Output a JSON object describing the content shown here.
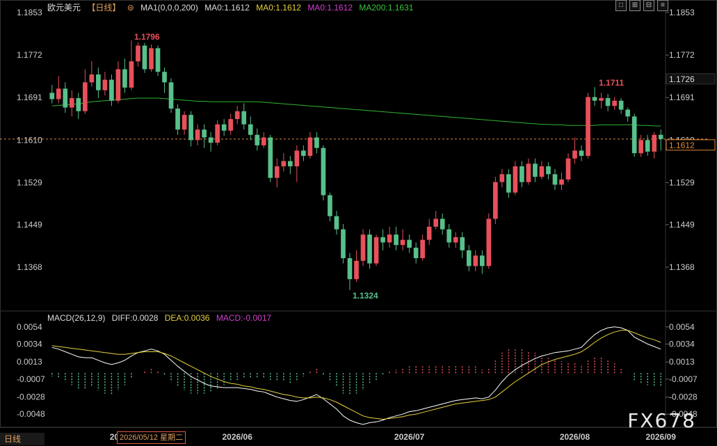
{
  "header": {
    "symbol": "欧元美元",
    "period": "【日线】",
    "ma_label": "MA1(0,0,0,200)",
    "ma0_white": "MA0:1.1612",
    "ma0_yellow": "MA0:1.1612",
    "ma0_magenta": "MA0:1.1612",
    "ma200": "MA200:1.1631"
  },
  "macd_header": {
    "label": "MACD(26,12,9)",
    "diff": "DIFF:0.0028",
    "dea": "DEA:0.0036",
    "macd": "MACD:-0.0017"
  },
  "bottom": {
    "tab_label": "日线",
    "selected_date": "2026/05/12 星期二",
    "watermark": "FX678"
  },
  "toolbar": [
    "□",
    "⊞",
    "⊟",
    "≡"
  ],
  "colors": {
    "up": "#e8505b",
    "down": "#58c08a",
    "ma200": "#2fb52f",
    "diff": "#ffffff",
    "dea": "#e6d23c",
    "price_line": "#e08a3a"
  },
  "chart_data": [
    {
      "type": "candlestick",
      "title": "欧元美元",
      "ylim": [
        1.1287,
        1.1853
      ],
      "y_ticks": [
        "1.1853",
        "1.1772",
        "1.1691",
        "1.1610",
        "1.1529",
        "1.1449",
        "1.1368"
      ],
      "x_ticks": [
        "2026/05",
        "2026/06",
        "2026/07",
        "2026/08",
        "2026/09"
      ],
      "annotations": {
        "high": "1.1796",
        "low": "1.1324",
        "recent_high": "1.1711"
      },
      "current_price": "1.1612",
      "ma200_label_value": "1.1726",
      "candles": [
        [
          1.17,
          1.1688,
          1.1715,
          1.168
        ],
        [
          1.1688,
          1.1708,
          1.1732,
          1.168
        ],
        [
          1.1708,
          1.1672,
          1.172,
          1.1662
        ],
        [
          1.1672,
          1.169,
          1.1705,
          1.1655
        ],
        [
          1.169,
          1.1665,
          1.17,
          1.165
        ],
        [
          1.1665,
          1.172,
          1.1745,
          1.166
        ],
        [
          1.172,
          1.1735,
          1.176,
          1.1712
        ],
        [
          1.1735,
          1.1705,
          1.1748,
          1.169
        ],
        [
          1.1705,
          1.1725,
          1.174,
          1.1695
        ],
        [
          1.1725,
          1.1685,
          1.1735,
          1.1675
        ],
        [
          1.1685,
          1.1745,
          1.176,
          1.168
        ],
        [
          1.1745,
          1.171,
          1.1765,
          1.17
        ],
        [
          1.171,
          1.176,
          1.18,
          1.1705
        ],
        [
          1.176,
          1.179,
          1.1796,
          1.175
        ],
        [
          1.179,
          1.1745,
          1.1795,
          1.1738
        ],
        [
          1.1745,
          1.1785,
          1.1792,
          1.174
        ],
        [
          1.1785,
          1.174,
          1.179,
          1.1732
        ],
        [
          1.174,
          1.172,
          1.1748,
          1.17
        ],
        [
          1.172,
          1.167,
          1.1728,
          1.1662
        ],
        [
          1.167,
          1.163,
          1.1678,
          1.162
        ],
        [
          1.163,
          1.1658,
          1.1665,
          1.162
        ],
        [
          1.1658,
          1.161,
          1.1665,
          1.1598
        ],
        [
          1.161,
          1.163,
          1.164,
          1.16
        ],
        [
          1.163,
          1.1615,
          1.164,
          1.1595
        ],
        [
          1.1615,
          1.1605,
          1.1625,
          1.1588
        ],
        [
          1.1605,
          1.164,
          1.1648,
          1.16
        ],
        [
          1.164,
          1.1628,
          1.165,
          1.1618
        ],
        [
          1.1628,
          1.165,
          1.166,
          1.162
        ],
        [
          1.165,
          1.1665,
          1.1675,
          1.164
        ],
        [
          1.1665,
          1.164,
          1.168,
          1.163
        ],
        [
          1.164,
          1.162,
          1.1655,
          1.161
        ],
        [
          1.162,
          1.16,
          1.1632,
          1.159
        ],
        [
          1.16,
          1.1615,
          1.1625,
          1.1595
        ],
        [
          1.1615,
          1.1538,
          1.162,
          1.153
        ],
        [
          1.1538,
          1.156,
          1.1575,
          1.152
        ],
        [
          1.156,
          1.157,
          1.1585,
          1.155
        ],
        [
          1.157,
          1.156,
          1.158,
          1.1545
        ],
        [
          1.156,
          1.159,
          1.16,
          1.153
        ],
        [
          1.159,
          1.158,
          1.16,
          1.157
        ],
        [
          1.158,
          1.1615,
          1.1625,
          1.1575
        ],
        [
          1.1615,
          1.1595,
          1.1625,
          1.1585
        ],
        [
          1.1595,
          1.1505,
          1.16,
          1.1495
        ],
        [
          1.1505,
          1.1465,
          1.151,
          1.1455
        ],
        [
          1.1465,
          1.144,
          1.1475,
          1.143
        ],
        [
          1.144,
          1.1385,
          1.145,
          1.1375
        ],
        [
          1.1385,
          1.1345,
          1.1395,
          1.1324
        ],
        [
          1.1345,
          1.138,
          1.14,
          1.134
        ],
        [
          1.138,
          1.143,
          1.144,
          1.137
        ],
        [
          1.143,
          1.1375,
          1.144,
          1.1365
        ],
        [
          1.1375,
          1.1425,
          1.143,
          1.137
        ],
        [
          1.1425,
          1.1415,
          1.144,
          1.14
        ],
        [
          1.1415,
          1.143,
          1.1445,
          1.1405
        ],
        [
          1.143,
          1.141,
          1.1445,
          1.14
        ],
        [
          1.141,
          1.142,
          1.144,
          1.14
        ],
        [
          1.142,
          1.1405,
          1.143,
          1.1395
        ],
        [
          1.1405,
          1.1385,
          1.1415,
          1.1375
        ],
        [
          1.1385,
          1.142,
          1.143,
          1.138
        ],
        [
          1.142,
          1.1445,
          1.146,
          1.141
        ],
        [
          1.1445,
          1.146,
          1.1475,
          1.144
        ],
        [
          1.146,
          1.144,
          1.147,
          1.143
        ],
        [
          1.144,
          1.1415,
          1.145,
          1.1405
        ],
        [
          1.1415,
          1.1425,
          1.1435,
          1.1405
        ],
        [
          1.1425,
          1.14,
          1.1435,
          1.1385
        ],
        [
          1.14,
          1.137,
          1.141,
          1.136
        ],
        [
          1.137,
          1.139,
          1.14,
          1.136
        ],
        [
          1.139,
          1.137,
          1.14,
          1.1355
        ],
        [
          1.137,
          1.146,
          1.147,
          1.1365
        ],
        [
          1.146,
          1.153,
          1.154,
          1.145
        ],
        [
          1.153,
          1.1545,
          1.1555,
          1.152
        ],
        [
          1.1545,
          1.151,
          1.1555,
          1.15
        ],
        [
          1.151,
          1.156,
          1.157,
          1.1505
        ],
        [
          1.156,
          1.153,
          1.157,
          1.152
        ],
        [
          1.153,
          1.1565,
          1.1575,
          1.1525
        ],
        [
          1.1565,
          1.154,
          1.1575,
          1.153
        ],
        [
          1.154,
          1.156,
          1.157,
          1.1535
        ],
        [
          1.156,
          1.1545,
          1.1568,
          1.1535
        ],
        [
          1.1545,
          1.1525,
          1.1555,
          1.1515
        ],
        [
          1.1525,
          1.1535,
          1.1548,
          1.1515
        ],
        [
          1.1535,
          1.1575,
          1.1585,
          1.153
        ],
        [
          1.1575,
          1.159,
          1.1615,
          1.1565
        ],
        [
          1.159,
          1.158,
          1.16,
          1.157
        ],
        [
          1.158,
          1.1692,
          1.17,
          1.1575
        ],
        [
          1.1692,
          1.1685,
          1.1711,
          1.1675
        ],
        [
          1.1685,
          1.169,
          1.17,
          1.167
        ],
        [
          1.169,
          1.1675,
          1.1698,
          1.1665
        ],
        [
          1.1675,
          1.1685,
          1.1692,
          1.1668
        ],
        [
          1.1685,
          1.1668,
          1.169,
          1.166
        ],
        [
          1.1668,
          1.1655,
          1.1672,
          1.1645
        ],
        [
          1.1655,
          1.1585,
          1.166,
          1.1578
        ],
        [
          1.1585,
          1.161,
          1.162,
          1.1578
        ],
        [
          1.161,
          1.1588,
          1.162,
          1.158
        ],
        [
          1.1588,
          1.162,
          1.1625,
          1.1575
        ],
        [
          1.162,
          1.1612,
          1.163,
          1.159
        ]
      ],
      "ma200": [
        1.1675,
        1.1676,
        1.1677,
        1.1678,
        1.1679,
        1.1681,
        1.1683,
        1.1684,
        1.1685,
        1.1686,
        1.1687,
        1.1688,
        1.1689,
        1.169,
        1.169,
        1.169,
        1.169,
        1.1689,
        1.1688,
        1.1687,
        1.1686,
        1.1685,
        1.1684,
        1.1684,
        1.1683,
        1.1683,
        1.1683,
        1.1683,
        1.1683,
        1.1683,
        1.1683,
        1.1683,
        1.1682,
        1.1681,
        1.168,
        1.1679,
        1.1678,
        1.1677,
        1.1676,
        1.1675,
        1.1674,
        1.1673,
        1.1672,
        1.1671,
        1.167,
        1.1669,
        1.1668,
        1.1667,
        1.1666,
        1.1665,
        1.1664,
        1.1663,
        1.1662,
        1.1661,
        1.166,
        1.1659,
        1.1658,
        1.1657,
        1.1656,
        1.1655,
        1.1654,
        1.1653,
        1.1652,
        1.1651,
        1.165,
        1.1649,
        1.1648,
        1.1647,
        1.1646,
        1.1645,
        1.1644,
        1.1643,
        1.1642,
        1.1641,
        1.164,
        1.164,
        1.1639,
        1.1639,
        1.1638,
        1.1638,
        1.1638,
        1.1638,
        1.1638,
        1.1639,
        1.1639,
        1.1639,
        1.1639,
        1.1639,
        1.1639,
        1.1638,
        1.1638,
        1.1637,
        1.1637
      ]
    },
    {
      "type": "macd",
      "ylim": [
        -0.006,
        0.0062
      ],
      "y_ticks": [
        "0.0054",
        "0.0034",
        "0.0013",
        "-0.0007",
        "-0.0028",
        "-0.0048"
      ],
      "diff": [
        0.003,
        0.0028,
        0.0025,
        0.0022,
        0.0019,
        0.0018,
        0.0018,
        0.0015,
        0.0012,
        0.001,
        0.0012,
        0.0015,
        0.002,
        0.0024,
        0.0026,
        0.0028,
        0.0026,
        0.0022,
        0.0015,
        0.0008,
        0.0002,
        -0.0004,
        -0.0008,
        -0.0012,
        -0.0015,
        -0.0016,
        -0.0017,
        -0.0017,
        -0.0017,
        -0.0018,
        -0.0019,
        -0.0021,
        -0.0022,
        -0.0025,
        -0.0028,
        -0.003,
        -0.0032,
        -0.0033,
        -0.0031,
        -0.0028,
        -0.0025,
        -0.003,
        -0.0036,
        -0.0042,
        -0.005,
        -0.0055,
        -0.0058,
        -0.006,
        -0.0058,
        -0.0057,
        -0.0055,
        -0.0052,
        -0.005,
        -0.0048,
        -0.0045,
        -0.0044,
        -0.0042,
        -0.004,
        -0.0038,
        -0.0036,
        -0.0034,
        -0.0032,
        -0.0031,
        -0.003,
        -0.0029,
        -0.003,
        -0.0028,
        -0.002,
        -0.001,
        -0.0002,
        0.0004,
        0.0009,
        0.0013,
        0.0017,
        0.002,
        0.0022,
        0.0024,
        0.0025,
        0.0026,
        0.0028,
        0.003,
        0.0038,
        0.0045,
        0.005,
        0.0053,
        0.0054,
        0.0053,
        0.005,
        0.0042,
        0.0038,
        0.0034,
        0.0031,
        0.0028
      ],
      "dea": [
        0.0032,
        0.0031,
        0.003,
        0.0029,
        0.0028,
        0.0027,
        0.0026,
        0.0025,
        0.0024,
        0.0023,
        0.0022,
        0.0022,
        0.0023,
        0.0024,
        0.0025,
        0.0025,
        0.0025,
        0.0023,
        0.002,
        0.0016,
        0.0012,
        0.0008,
        0.0004,
        0.0,
        -0.0004,
        -0.0007,
        -0.001,
        -0.0012,
        -0.0013,
        -0.0015,
        -0.0016,
        -0.0018,
        -0.0019,
        -0.0021,
        -0.0023,
        -0.0025,
        -0.0026,
        -0.0028,
        -0.0029,
        -0.0029,
        -0.0028,
        -0.0029,
        -0.0031,
        -0.0034,
        -0.0038,
        -0.0042,
        -0.0046,
        -0.005,
        -0.0052,
        -0.0053,
        -0.0054,
        -0.0053,
        -0.0052,
        -0.0051,
        -0.0049,
        -0.0048,
        -0.0046,
        -0.0044,
        -0.0042,
        -0.004,
        -0.0038,
        -0.0036,
        -0.0035,
        -0.0034,
        -0.0033,
        -0.0032,
        -0.0031,
        -0.0028,
        -0.0022,
        -0.0016,
        -0.001,
        -0.0005,
        0.0,
        0.0005,
        0.001,
        0.0013,
        0.0016,
        0.0018,
        0.002,
        0.0022,
        0.0025,
        0.003,
        0.0036,
        0.0041,
        0.0045,
        0.0048,
        0.005,
        0.005,
        0.0047,
        0.0044,
        0.0041,
        0.0039,
        0.0036
      ]
    }
  ]
}
